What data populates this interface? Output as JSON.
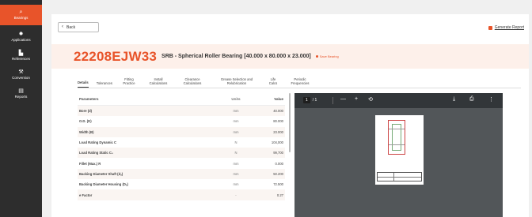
{
  "sidebar": {
    "items": [
      {
        "label": "Bearings",
        "icon": "search-icon",
        "glyph": "⌕",
        "active": true
      },
      {
        "label": "Applications",
        "icon": "gear-icon",
        "glyph": "✹",
        "active": false
      },
      {
        "label": "References",
        "icon": "books-icon",
        "glyph": "▙",
        "active": false
      },
      {
        "label": "Conversion",
        "icon": "wrench-icon",
        "glyph": "⚒",
        "active": false
      },
      {
        "label": "Reports",
        "icon": "report-icon",
        "glyph": "▤",
        "active": false
      }
    ]
  },
  "header": {
    "back_label": "Back",
    "generate_report_label": "Generate Report"
  },
  "bearing": {
    "part_number": "22208EJW33",
    "description": "SRB - Spherical Roller Bearing [40.000 x 80.000 x 23.000]",
    "favorite_label": "Save Bearing"
  },
  "tabs": [
    {
      "label": "Details",
      "active": true
    },
    {
      "label": "Tolerances",
      "active": false
    },
    {
      "label": "Fitting Practice",
      "active": false
    },
    {
      "label": "Install Calculations",
      "active": false
    },
    {
      "label": "Clearance Calculations",
      "active": false
    },
    {
      "label": "Grease Selection and Relubrication",
      "active": false
    },
    {
      "label": "Life Calcs",
      "active": false
    },
    {
      "label": "Periodic Frequencies",
      "active": false
    }
  ],
  "table": {
    "headers": {
      "param": "Parameters",
      "unit": "Units",
      "value": "Value"
    },
    "rows": [
      {
        "param": "Bore (d)",
        "unit": "mm",
        "value": "40.000"
      },
      {
        "param": "O.D. (D)",
        "unit": "mm",
        "value": "80.000"
      },
      {
        "param": "Width (B)",
        "unit": "mm",
        "value": "23.000"
      },
      {
        "param": "Load Rating Dynamic C",
        "unit": "N",
        "value": "104,000"
      },
      {
        "param": "Load Rating Static C₀",
        "unit": "N",
        "value": "99,700"
      },
      {
        "param": "Fillet (Max.) R",
        "unit": "mm",
        "value": "0.000"
      },
      {
        "param": "Backing Diameter Shaft (dₐ)",
        "unit": "mm",
        "value": "50.200"
      },
      {
        "param": "Backing Diameter Housing (Dₐ)",
        "unit": "mm",
        "value": "72.500"
      },
      {
        "param": "e Factor",
        "unit": "-",
        "value": "0.27"
      }
    ]
  },
  "pdf_viewer": {
    "current_page": "1",
    "page_total": "/ 1",
    "zoom_out": "—",
    "zoom_in": "+",
    "download_icon": "download-icon",
    "print_icon": "print-icon",
    "more_icon": "more-vertical-icon"
  },
  "colors": {
    "accent": "#e8542a",
    "sidebar_bg": "#2d2d2d",
    "title_band": "#fdf0ea",
    "viewer_bg": "#525659",
    "viewer_bar": "#323639"
  }
}
